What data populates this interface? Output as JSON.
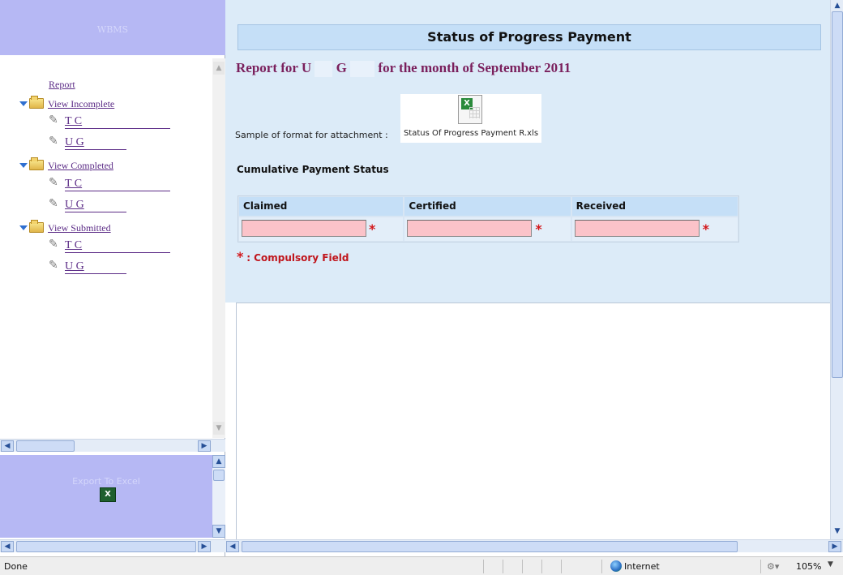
{
  "left_panel": {
    "header_faint": "WBMS",
    "tree": {
      "report_label": "Report",
      "sections": [
        {
          "label": "View Incomplete",
          "items": [
            "T       C",
            "U       G"
          ]
        },
        {
          "label": "View Completed",
          "items": [
            "T       C",
            "U       G"
          ]
        },
        {
          "label": "View Submitted",
          "items": [
            "T       C",
            "U       G"
          ]
        }
      ]
    },
    "bottom_faint": "Export To Excel",
    "bottom_icon": "excel-icon"
  },
  "main": {
    "title": "Status of Progress Payment",
    "report_prefix": "Report for U",
    "report_mid": "G",
    "report_suffix": "for the month of September 2011",
    "attachment_label": "Sample of format for attachment :",
    "attachment_file": "Status Of Progress Payment R.xls",
    "cumulative_title": "Cumulative Payment Status",
    "table": {
      "columns": [
        "Claimed",
        "Certified",
        "Received"
      ],
      "values": [
        "",
        "",
        ""
      ]
    },
    "required_marker": "*",
    "compulsory_text": ": Compulsory Field"
  },
  "status_bar": {
    "status": "Done",
    "zone": "Internet",
    "zoom": "105%"
  },
  "colors": {
    "sidebar_bg": "#b6b8f4",
    "content_bg": "#dcebf8",
    "title_bg": "#c5dff7",
    "heading_color": "#7a1f5c",
    "input_bg": "#fbc3c9",
    "required_color": "#d3181c"
  }
}
